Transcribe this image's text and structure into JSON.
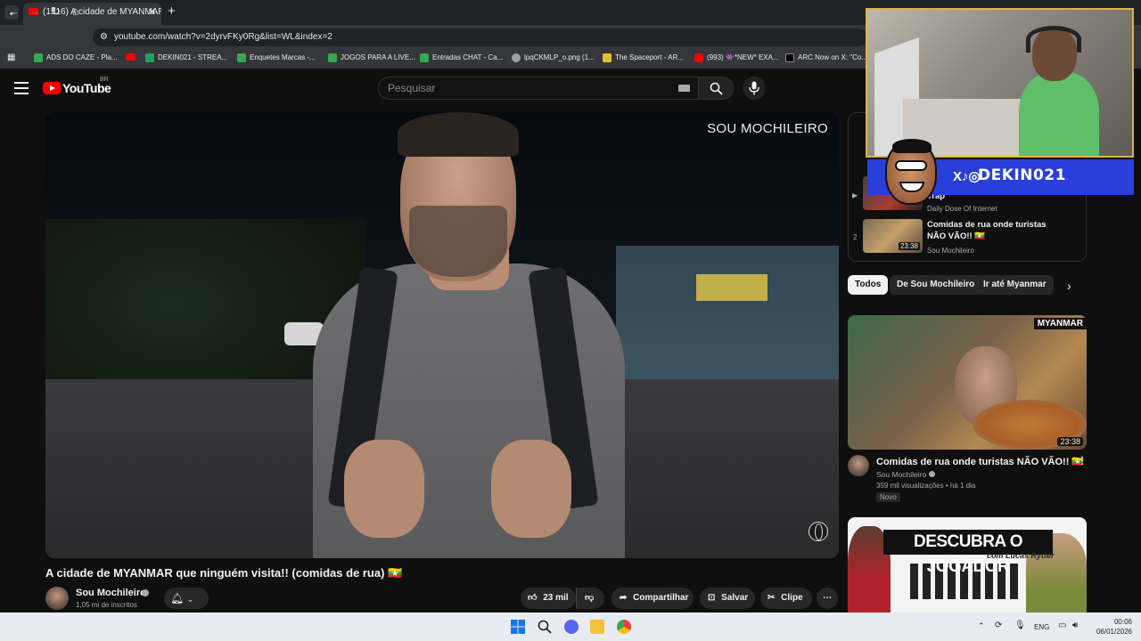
{
  "browser": {
    "tab_title": "(1516) A cidade de MYANMAR",
    "url": "youtube.com/watch?v=2dyrvFKy0Rg&list=WL&index=2",
    "bookmarks": [
      {
        "label": "ADS DO CAZE - Pla...",
        "color": "#34a853"
      },
      {
        "label": "DEKIN021 - STREA...",
        "color": "#1fa463"
      },
      {
        "label": "Enquetes Marcas -...",
        "color": "#34a853"
      },
      {
        "label": "JOGOS PARA A LIVE...",
        "color": "#34a853"
      },
      {
        "label": "Entradas CHAT - Ca...",
        "color": "#34a853"
      },
      {
        "label": "lpqCKMLP_o.png (1...",
        "color": "#9aa0a6"
      },
      {
        "label": "The Spaceport - AR...",
        "color": "#e5c12d"
      },
      {
        "label": "(993) 👾*NEW* EXA...",
        "color": "#ff0000"
      },
      {
        "label": "ARC Now on X: \"Co...",
        "color": "#000000"
      }
    ]
  },
  "youtube": {
    "logo_text": "YouTube",
    "country": "BR",
    "search_placeholder": "Pesquisar",
    "video": {
      "watermark": "SOU MOCHILEIRO",
      "title": "A cidade de MYANMAR que ninguém visita!! (comidas de rua) 🇲🇲",
      "channel": "Sou Mochileiro",
      "subscribers": "1,05 mi de inscritos",
      "likes": "23 mil",
      "share_label": "Compartilhar",
      "save_label": "Salvar",
      "clip_label": "Clipe"
    },
    "playlist": {
      "items": [
        {
          "index": "",
          "title": "Trap",
          "channel": "Daily Dose Of Internet",
          "duration": ""
        },
        {
          "index": "2",
          "title": "Comidas de rua onde turistas NÃO VÃO!! 🇲🇲",
          "channel": "Sou Mochileiro",
          "duration": "23:38"
        }
      ]
    },
    "chips": [
      "Todos",
      "De Sou Mochileiro",
      "Ir até Myanmar"
    ],
    "recommendations": [
      {
        "thumb_tag": "MYANMAR",
        "duration": "23:38",
        "title": "Comidas de rua onde turistas NÃO VÃO!! 🇲🇲",
        "channel": "Sou Mochileiro",
        "meta": "359 mil visualizações • há 1 dia",
        "badge": "Novo"
      },
      {
        "thumb_banner": "DESCUBRA O JOGADOR",
        "thumb_sub": "com Lucas Rytter"
      }
    ]
  },
  "overlay": {
    "handle": "DEKIN021",
    "socials": "X♪◎"
  },
  "taskbar": {
    "lang": "ENG",
    "time": "00:06",
    "date": "06/01/2026"
  },
  "colors": {
    "youtube_red": "#ff0000",
    "overlay_border": "#e0b14a",
    "overlay_banner": "#2a3fd9"
  }
}
